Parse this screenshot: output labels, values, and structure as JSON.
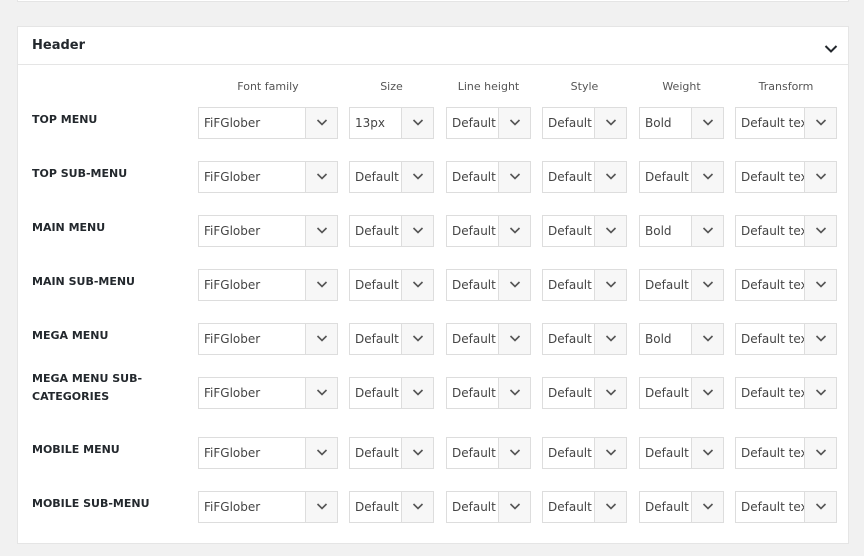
{
  "section": {
    "title": "Header",
    "toggle_icon": "chevron-down-icon"
  },
  "columns": [
    "Font family",
    "Size",
    "Line height",
    "Style",
    "Weight",
    "Transform"
  ],
  "rows": [
    {
      "label": [
        "TOP MENU"
      ],
      "values": [
        "FiFGlober",
        "13px",
        "Default",
        "Default",
        "Bold",
        "Default tex"
      ]
    },
    {
      "label": [
        "TOP SUB-MENU"
      ],
      "values": [
        "FiFGlober",
        "Default",
        "Default",
        "Default",
        "Default",
        "Default tex"
      ]
    },
    {
      "label": [
        "MAIN MENU"
      ],
      "values": [
        "FiFGlober",
        "Default",
        "Default",
        "Default",
        "Bold",
        "Default tex"
      ]
    },
    {
      "label": [
        "MAIN SUB-MENU"
      ],
      "values": [
        "FiFGlober",
        "Default",
        "Default",
        "Default",
        "Default",
        "Default tex"
      ]
    },
    {
      "label": [
        "MEGA MENU"
      ],
      "values": [
        "FiFGlober",
        "Default",
        "Default",
        "Default",
        "Bold",
        "Default tex"
      ]
    },
    {
      "label": [
        "MEGA MENU SUB-",
        "CATEGORIES"
      ],
      "values": [
        "FiFGlober",
        "Default",
        "Default",
        "Default",
        "Default",
        "Default tex"
      ]
    },
    {
      "label": [
        "MOBILE MENU"
      ],
      "values": [
        "FiFGlober",
        "Default",
        "Default",
        "Default",
        "Default",
        "Default tex"
      ]
    },
    {
      "label": [
        "MOBILE SUB-MENU"
      ],
      "values": [
        "FiFGlober",
        "Default",
        "Default",
        "Default",
        "Default",
        "Default tex"
      ]
    }
  ]
}
